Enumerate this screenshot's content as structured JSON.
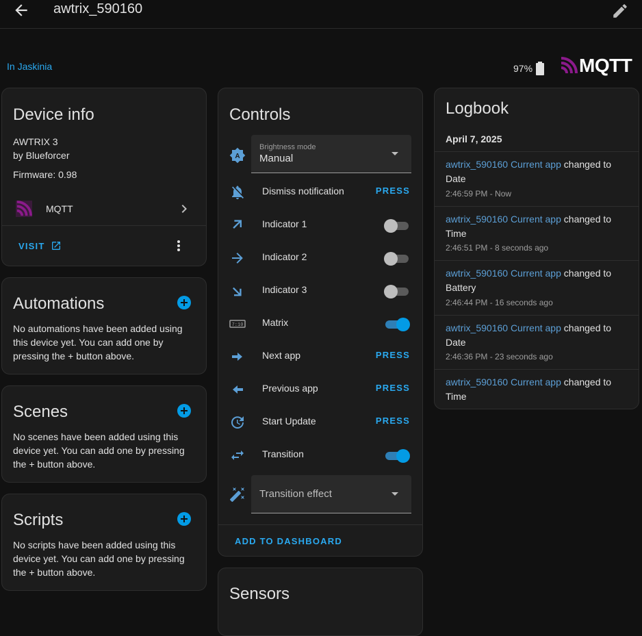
{
  "header": {
    "title": "awtrix_590160"
  },
  "area": {
    "link": "In Jaskinia"
  },
  "battery": {
    "level": "97%"
  },
  "integration_logo": {
    "text": "MQTT"
  },
  "device_info": {
    "title": "Device info",
    "model": "AWTRIX 3",
    "manufacturer": "by Blueforcer",
    "firmware": "Firmware: 0.98",
    "integration": "MQTT",
    "visit_label": "VISIT"
  },
  "automations": {
    "title": "Automations",
    "description": "No automations have been added using this device yet. You can add one by pressing the + button above."
  },
  "scenes": {
    "title": "Scenes",
    "description": "No scenes have been added using this device yet. You can add one by pressing the + button above."
  },
  "scripts": {
    "title": "Scripts",
    "description": "No scripts have been added using this device yet. You can add one by pressing the + button above."
  },
  "controls": {
    "title": "Controls",
    "brightness_mode": {
      "label": "Brightness mode",
      "value": "Manual"
    },
    "rows": [
      {
        "label": "Dismiss notification",
        "action": "PRESS",
        "icon": "bell-off-icon"
      },
      {
        "label": "Indicator 1",
        "state": "off",
        "icon": "arrow-top-right-icon"
      },
      {
        "label": "Indicator 2",
        "state": "off",
        "icon": "arrow-right-icon"
      },
      {
        "label": "Indicator 3",
        "state": "off",
        "icon": "arrow-bottom-right-icon"
      },
      {
        "label": "Matrix",
        "state": "on",
        "icon": "led-matrix-icon"
      },
      {
        "label": "Next app",
        "action": "PRESS",
        "icon": "arrow-right-bold-icon"
      },
      {
        "label": "Previous app",
        "action": "PRESS",
        "icon": "arrow-left-bold-icon"
      },
      {
        "label": "Start Update",
        "action": "PRESS",
        "icon": "update-icon"
      },
      {
        "label": "Transition",
        "state": "on",
        "icon": "swap-icon"
      }
    ],
    "transition_effect": {
      "placeholder": "Transition effect"
    },
    "add_to_dashboard": "ADD TO DASHBOARD"
  },
  "sensors": {
    "title": "Sensors"
  },
  "logbook": {
    "title": "Logbook",
    "date": "April 7, 2025",
    "entries": [
      {
        "entity": "awtrix_590160 Current app",
        "action": "changed to",
        "state": "Date",
        "time": "2:46:59 PM - Now"
      },
      {
        "entity": "awtrix_590160 Current app",
        "action": "changed to",
        "state": "Time",
        "time": "2:46:51 PM - 8 seconds ago"
      },
      {
        "entity": "awtrix_590160 Current app",
        "action": "changed to",
        "state": "Battery",
        "time": "2:46:44 PM - 16 seconds ago"
      },
      {
        "entity": "awtrix_590160 Current app",
        "action": "changed to",
        "state": "Date",
        "time": "2:46:36 PM - 23 seconds ago"
      },
      {
        "entity": "awtrix_590160 Current app",
        "action": "changed to",
        "state": "Time",
        "time": ""
      }
    ]
  },
  "colors": {
    "accent": "#039be5",
    "link": "#2aa9f0",
    "icon": "#5c9fd6",
    "card": "#1c1c1c",
    "background": "#111111"
  }
}
